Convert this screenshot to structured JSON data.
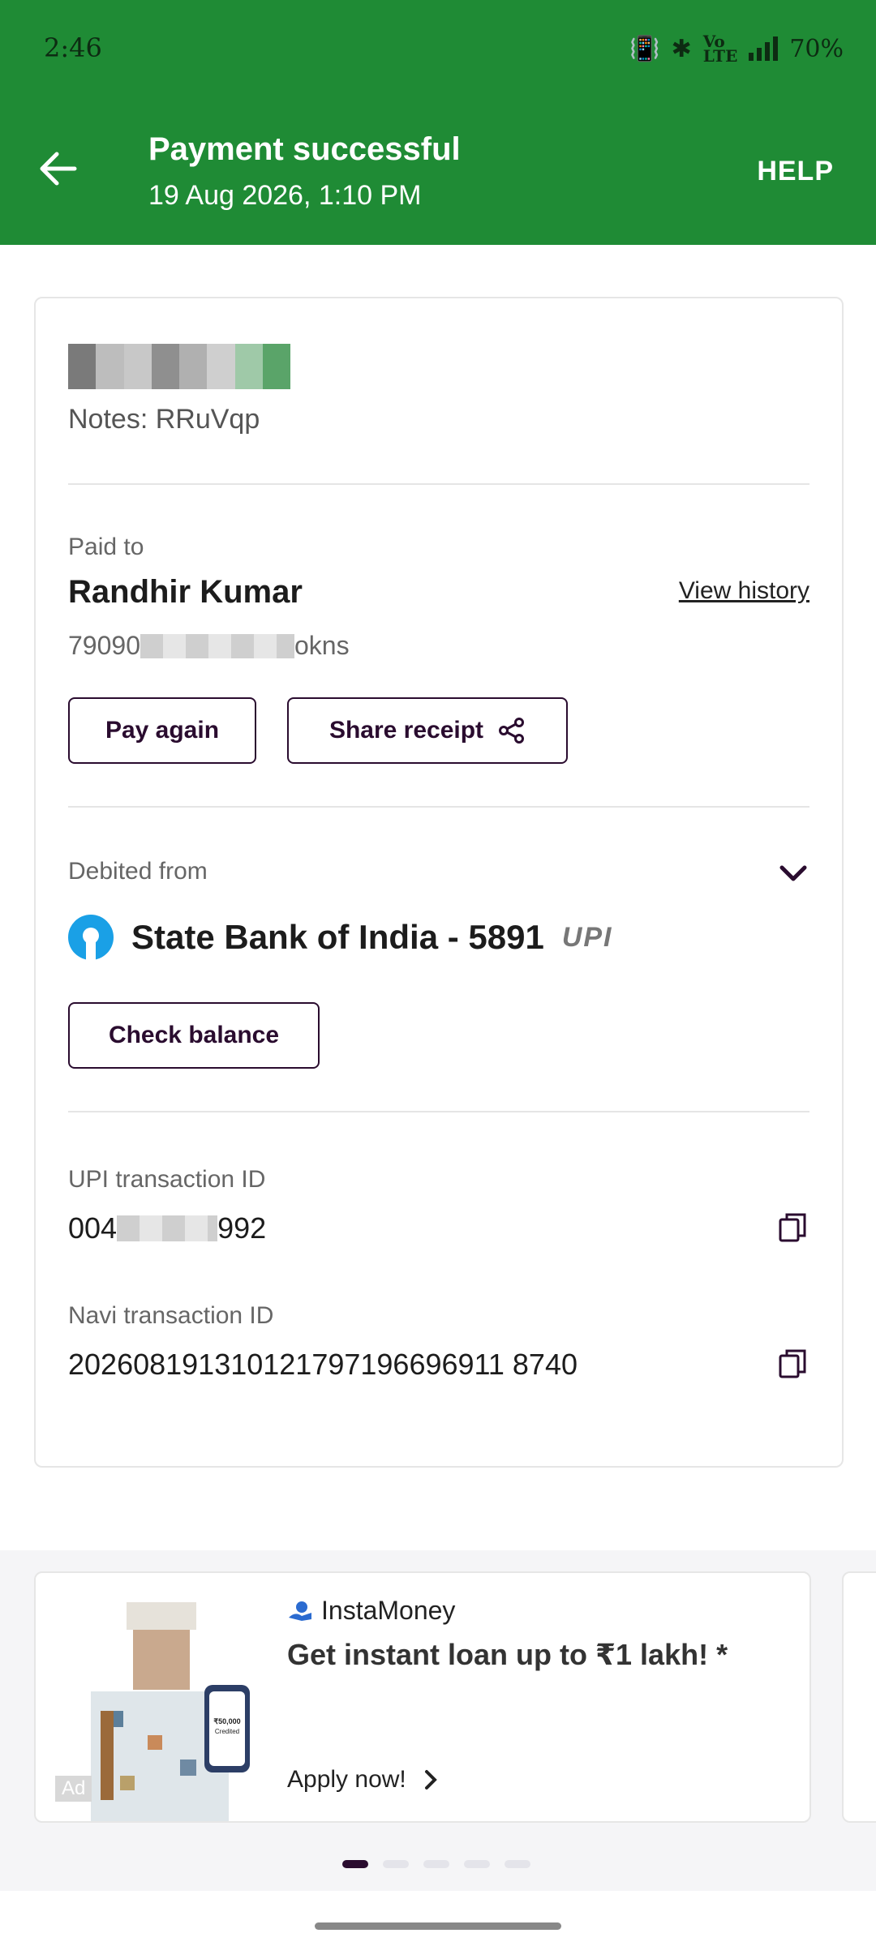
{
  "status_bar": {
    "time": "2:46",
    "battery": "70%"
  },
  "header": {
    "title": "Payment successful",
    "datetime": "19 Aug 2026, 1:10 PM",
    "help_label": "HELP"
  },
  "payment": {
    "notes": "Notes: RRuVqp",
    "paid_to_label": "Paid to",
    "payee_name": "Randhir Kumar",
    "view_history_label": "View history",
    "upi_id_prefix": "79090",
    "upi_id_suffix": "okns",
    "pay_again_label": "Pay again",
    "share_receipt_label": "Share receipt"
  },
  "debit": {
    "label": "Debited from",
    "bank": "State Bank of India - 5891",
    "upi_badge": "UPI",
    "check_balance_label": "Check balance"
  },
  "transaction": {
    "upi_label": "UPI transaction ID",
    "upi_prefix": "004",
    "upi_suffix": "992",
    "navi_label": "Navi transaction ID",
    "navi_id": "202608191310121797196696911 8740"
  },
  "ad": {
    "brand": "InstaMoney",
    "title": "Get instant loan up to ₹1 lakh! *",
    "cta": "Apply now!",
    "tag": "Ad",
    "carousel_count": 5,
    "active_index": 0
  },
  "colors": {
    "header_bg": "#1f8b35",
    "accent": "#2a0c2f",
    "bank_logo": "#1aa0e6"
  }
}
